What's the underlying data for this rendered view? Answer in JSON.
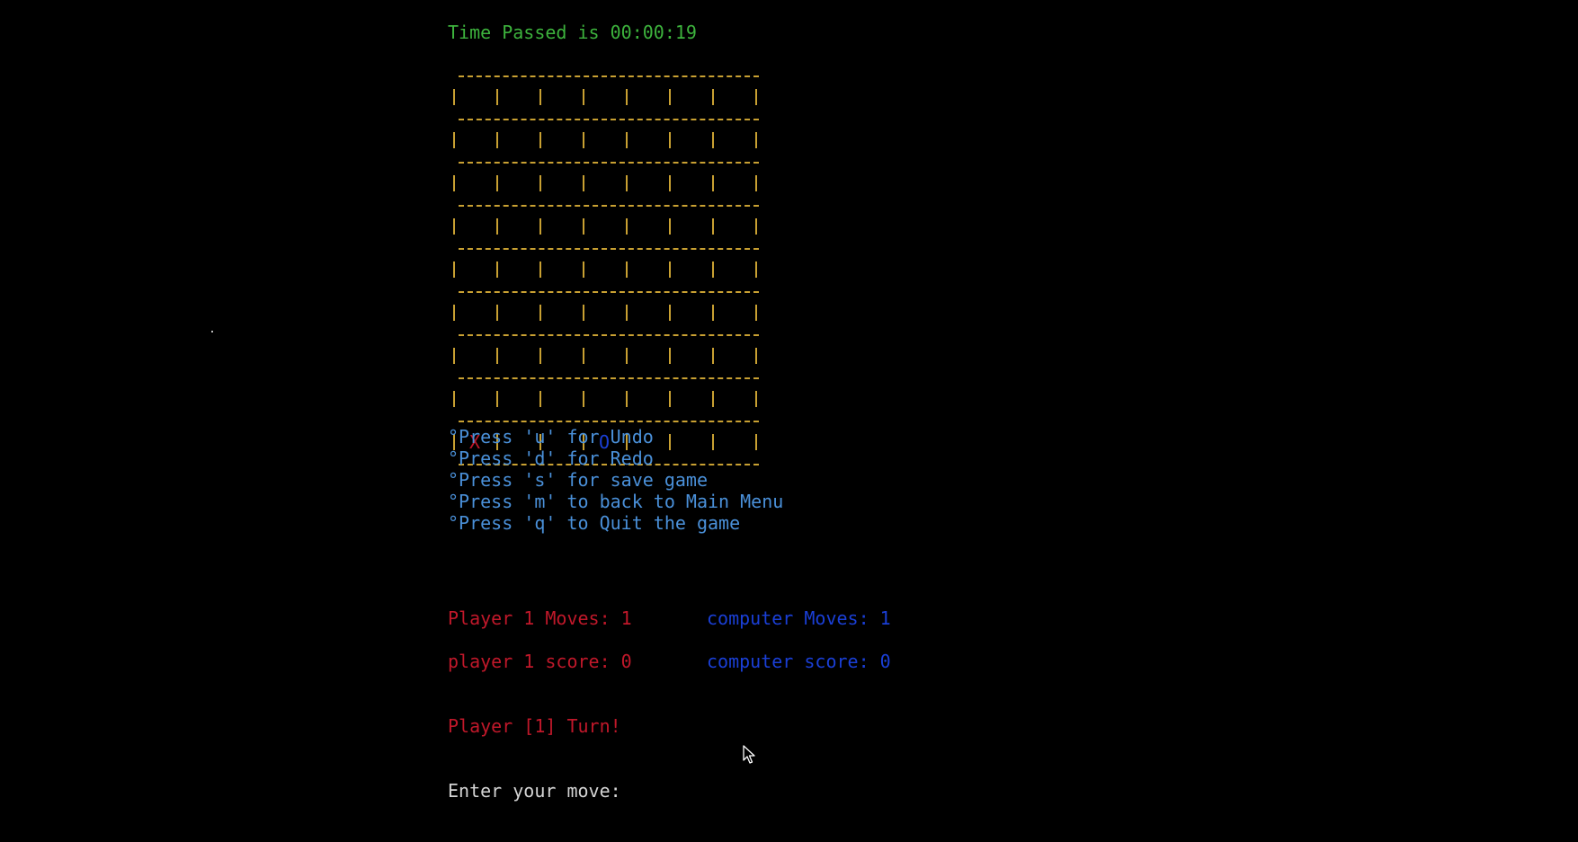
{
  "colors": {
    "background": "#000000",
    "timer": "#3db33d",
    "board": "#c8a032",
    "player": "#c0182a",
    "computer": "#1a3fd6",
    "menu": "#4a90d9",
    "prompt": "#d4d4d4"
  },
  "timer": {
    "text": "Time Passed is 00:00:19"
  },
  "board": {
    "rows": 9,
    "columns": 7,
    "pieces": [
      {
        "row": 9,
        "col": 1,
        "symbol": "X",
        "owner": "player"
      },
      {
        "row": 9,
        "col": 4,
        "symbol": "O",
        "owner": "computer"
      }
    ]
  },
  "menu": {
    "items": [
      "°Press 'u' for Undo",
      "°Press 'd' for Redo",
      "°Press 's' for save game",
      "°Press 'm' to back to Main Menu",
      "°Press 'q' to Quit the game"
    ]
  },
  "stats": {
    "player_moves": "Player 1 Moves: 1",
    "computer_moves": "computer Moves: 1",
    "player_score": "player 1 score: 0",
    "computer_score": "computer score: 0"
  },
  "turn": {
    "text": "Player [1] Turn!"
  },
  "prompt": {
    "text": "Enter your move:"
  },
  "icons": {
    "cursor": "mouse-pointer-icon"
  }
}
